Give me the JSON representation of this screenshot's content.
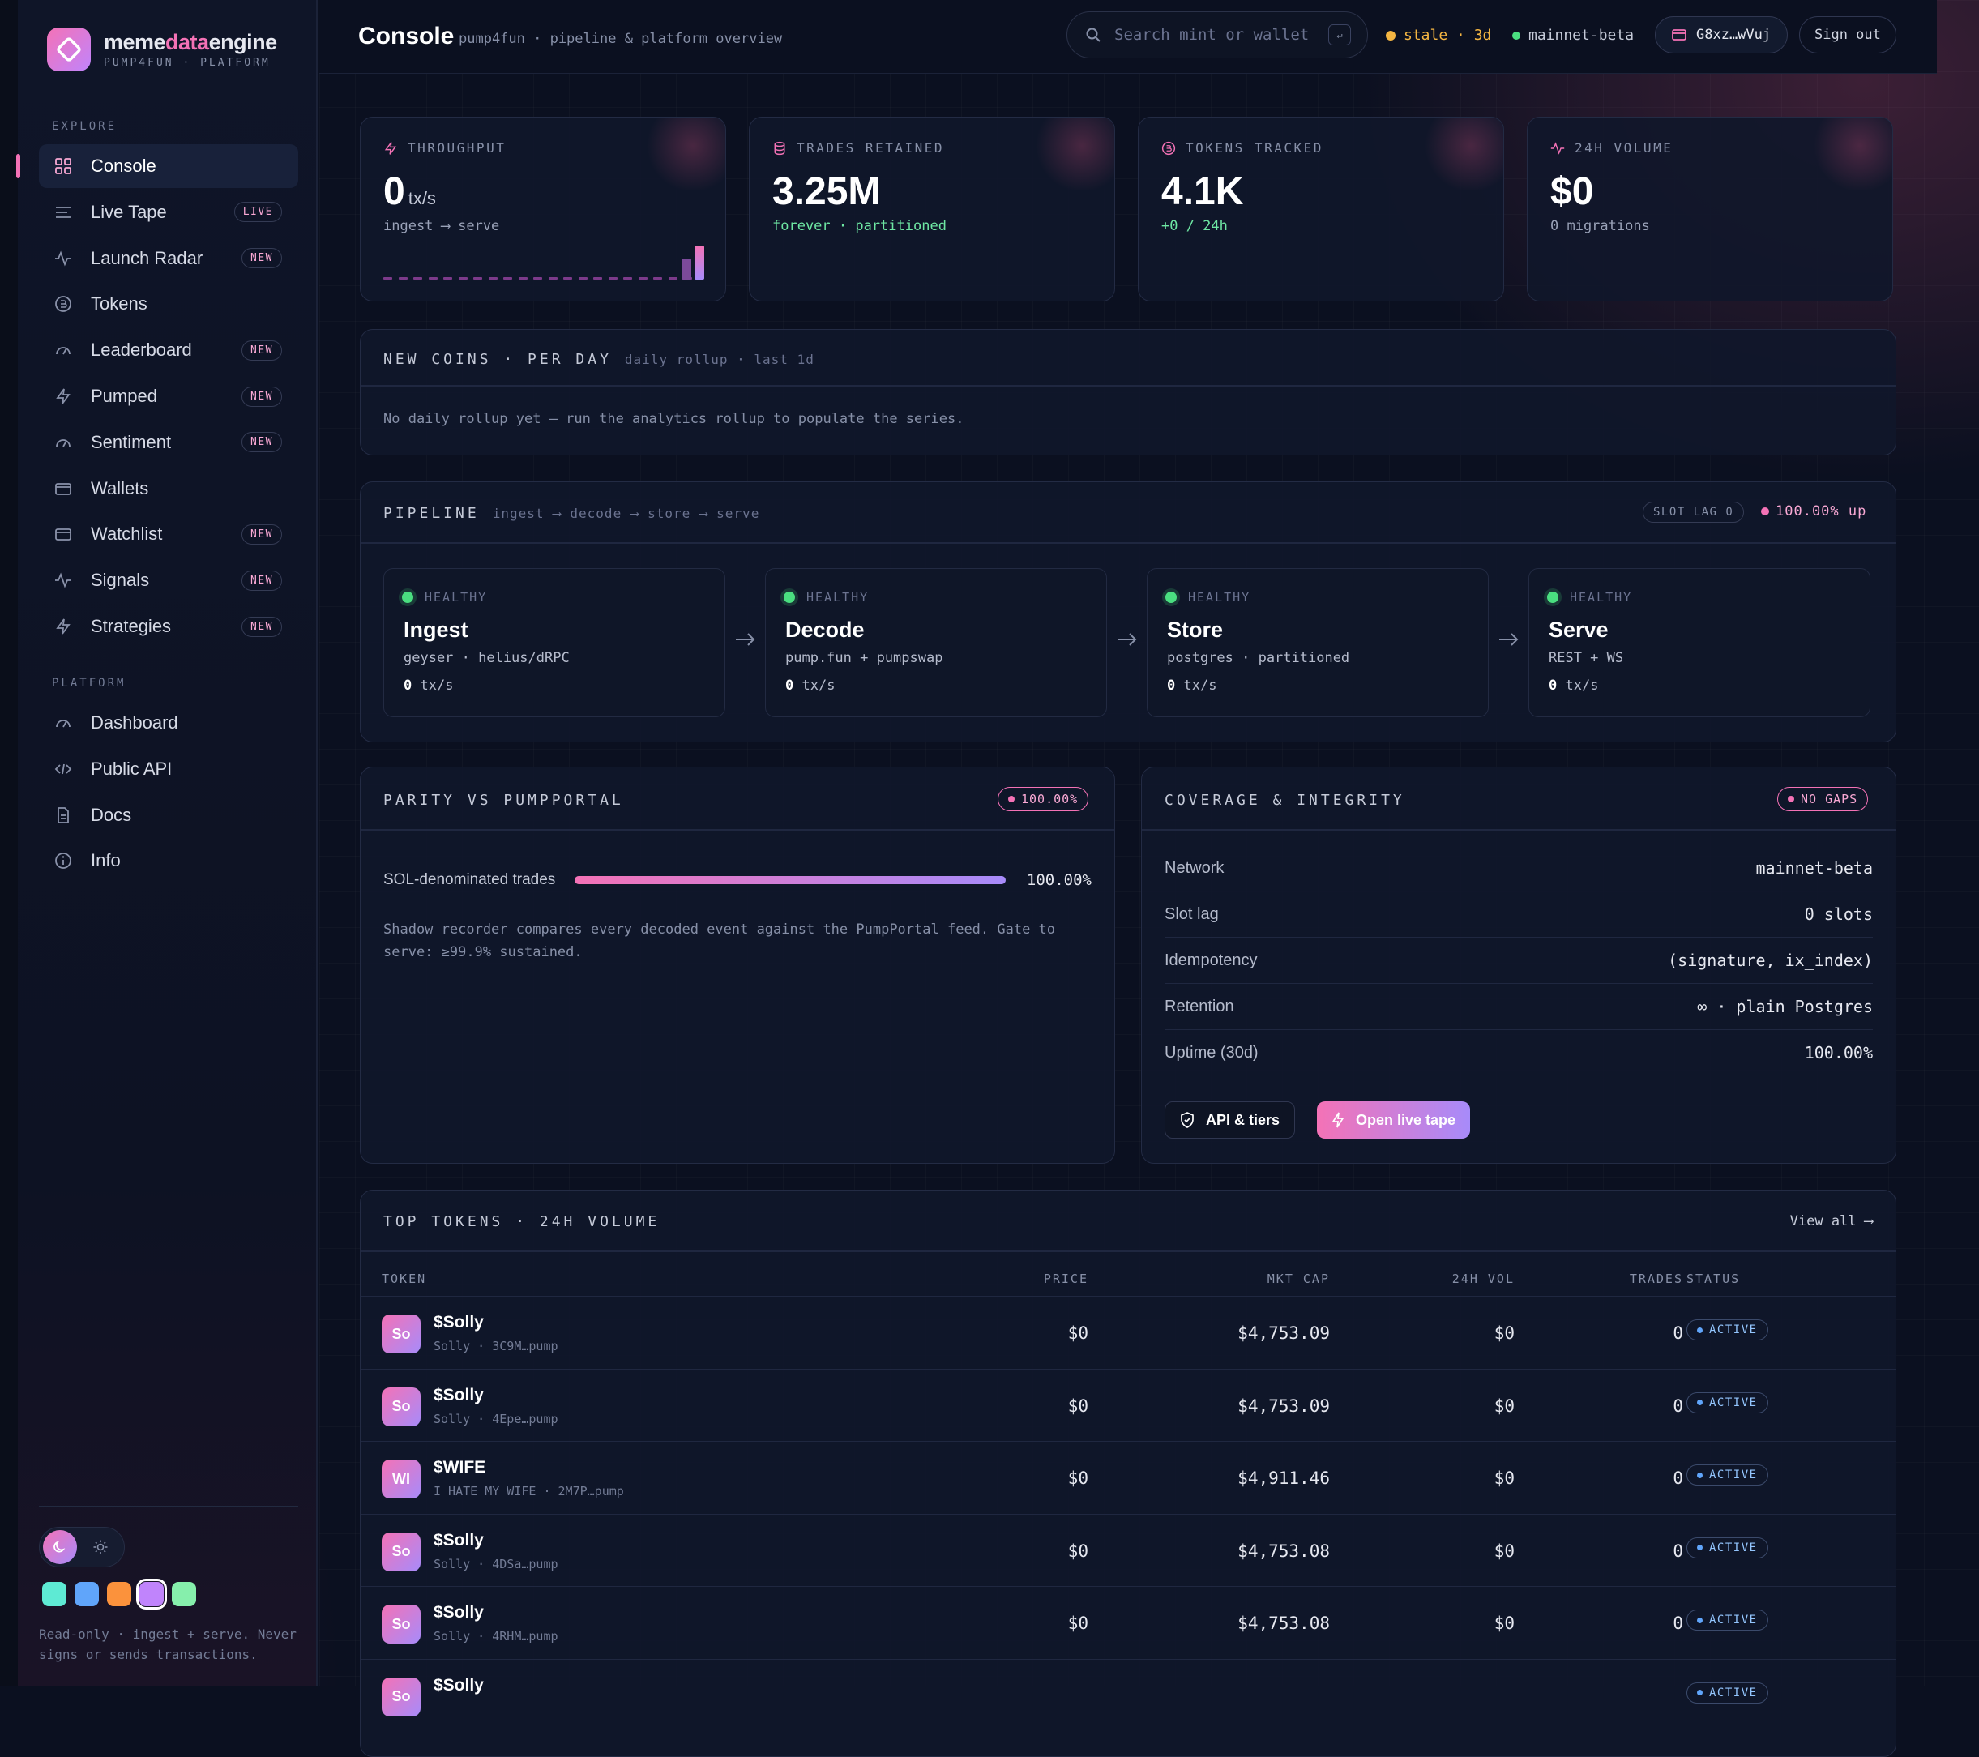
{
  "brand": {
    "name_part1": "meme",
    "name_part2": "data",
    "name_part3": "engine",
    "subtitle": "PUMP4FUN · PLATFORM"
  },
  "sidebar": {
    "explore_label": "EXPLORE",
    "platform_label": "PLATFORM",
    "explore_items": [
      {
        "label": "Console",
        "badge": "",
        "icon": "grid-icon",
        "active": true
      },
      {
        "label": "Live Tape",
        "badge": "LIVE",
        "icon": "lines-icon"
      },
      {
        "label": "Launch Radar",
        "badge": "NEW",
        "icon": "pulse-icon"
      },
      {
        "label": "Tokens",
        "badge": "",
        "icon": "coin-icon"
      },
      {
        "label": "Leaderboard",
        "badge": "NEW",
        "icon": "gauge-icon"
      },
      {
        "label": "Pumped",
        "badge": "NEW",
        "icon": "bolt-icon"
      },
      {
        "label": "Sentiment",
        "badge": "NEW",
        "icon": "gauge-icon"
      },
      {
        "label": "Wallets",
        "badge": "",
        "icon": "wallet-icon"
      },
      {
        "label": "Watchlist",
        "badge": "NEW",
        "icon": "wallet-icon"
      },
      {
        "label": "Signals",
        "badge": "NEW",
        "icon": "pulse-icon"
      },
      {
        "label": "Strategies",
        "badge": "NEW",
        "icon": "bolt-icon"
      }
    ],
    "platform_items": [
      {
        "label": "Dashboard",
        "icon": "gauge-icon"
      },
      {
        "label": "Public API",
        "icon": "code-icon"
      },
      {
        "label": "Docs",
        "icon": "doc-icon"
      },
      {
        "label": "Info",
        "icon": "info-icon"
      }
    ],
    "swatch_colors": [
      "#5eead4",
      "#60a5fa",
      "#fb923c",
      "#c084fc",
      "#86efac"
    ],
    "footer_note": "Read-only · ingest + serve. Never signs or sends transactions."
  },
  "header": {
    "title": "Console",
    "subtitle": "pump4fun · pipeline & platform overview",
    "search_placeholder": "Search mint or wallet",
    "search_kbd": "↵",
    "stale_label": "stale · 3d",
    "network_label": "mainnet-beta",
    "wallet_label": "G8xz…wVuj",
    "signout_label": "Sign out"
  },
  "stats": [
    {
      "label": "THROUGHPUT",
      "value": "0",
      "unit": "tx/s",
      "sub": "ingest ⟶ serve",
      "sub_color": "muted",
      "icon": "bolt-icon"
    },
    {
      "label": "TRADES RETAINED",
      "value": "3.25M",
      "unit": "",
      "sub": "forever · partitioned",
      "sub_color": "green",
      "icon": "database-icon"
    },
    {
      "label": "TOKENS TRACKED",
      "value": "4.1K",
      "unit": "",
      "sub": "+0 / 24h",
      "sub_color": "green",
      "icon": "coin-icon"
    },
    {
      "label": "24H VOLUME",
      "value": "$0",
      "unit": "",
      "sub": "0 migrations",
      "sub_color": "muted",
      "icon": "pulse-icon"
    }
  ],
  "new_coins": {
    "title": "NEW COINS · PER DAY",
    "meta": "daily rollup · last 1d",
    "empty": "No daily rollup yet — run the analytics rollup to populate the series."
  },
  "pipeline": {
    "title": "PIPELINE",
    "flow": "ingest ⟶ decode ⟶ store ⟶ serve",
    "slot_lag": "SLOT LAG 0",
    "uptime": "100.00% up",
    "stages": [
      {
        "status": "HEALTHY",
        "name": "Ingest",
        "desc": "geyser · helius/dRPC",
        "rate_value": "0",
        "rate_unit": "tx/s"
      },
      {
        "status": "HEALTHY",
        "name": "Decode",
        "desc": "pump.fun + pumpswap",
        "rate_value": "0",
        "rate_unit": "tx/s"
      },
      {
        "status": "HEALTHY",
        "name": "Store",
        "desc": "postgres · partitioned",
        "rate_value": "0",
        "rate_unit": "tx/s"
      },
      {
        "status": "HEALTHY",
        "name": "Serve",
        "desc": "REST + WS",
        "rate_value": "0",
        "rate_unit": "tx/s"
      }
    ]
  },
  "parity": {
    "title": "PARITY VS PUMPPORTAL",
    "badge": "100.00%",
    "metric_label": "SOL-denominated trades",
    "metric_value": "100.00%",
    "metric_fraction": 1.0,
    "note": "Shadow recorder compares every decoded event against the PumpPortal feed. Gate to serve: ≥99.9% sustained."
  },
  "coverage": {
    "title": "COVERAGE & INTEGRITY",
    "badge": "NO GAPS",
    "rows": [
      {
        "k": "Network",
        "v": "mainnet-beta"
      },
      {
        "k": "Slot lag",
        "v": "0 slots"
      },
      {
        "k": "Idempotency",
        "v": "(signature, ix_index)"
      },
      {
        "k": "Retention",
        "v": "∞ · plain Postgres"
      },
      {
        "k": "Uptime (30d)",
        "v": "100.00%"
      }
    ],
    "api_button": "API & tiers",
    "tape_button": "Open live tape"
  },
  "top_tokens": {
    "title": "TOP TOKENS · 24H VOLUME",
    "view_all": "View all ⟶",
    "columns": {
      "token": "TOKEN",
      "price": "PRICE",
      "mcap": "MKT CAP",
      "vol": "24H VOL",
      "trades": "TRADES",
      "status": "STATUS"
    },
    "rows": [
      {
        "avatar": "So",
        "symbol": "$Solly",
        "sub": "Solly · 3C9M…pump",
        "price": "$0",
        "mcap": "$4,753.09",
        "vol": "$0",
        "trades": "0",
        "status": "ACTIVE"
      },
      {
        "avatar": "So",
        "symbol": "$Solly",
        "sub": "Solly · 4Epe…pump",
        "price": "$0",
        "mcap": "$4,753.09",
        "vol": "$0",
        "trades": "0",
        "status": "ACTIVE"
      },
      {
        "avatar": "WI",
        "symbol": "$WIFE",
        "sub": "I HATE MY WIFE · 2M7P…pump",
        "price": "$0",
        "mcap": "$4,911.46",
        "vol": "$0",
        "trades": "0",
        "status": "ACTIVE"
      },
      {
        "avatar": "So",
        "symbol": "$Solly",
        "sub": "Solly · 4DSa…pump",
        "price": "$0",
        "mcap": "$4,753.08",
        "vol": "$0",
        "trades": "0",
        "status": "ACTIVE"
      },
      {
        "avatar": "So",
        "symbol": "$Solly",
        "sub": "Solly · 4RHM…pump",
        "price": "$0",
        "mcap": "$4,753.08",
        "vol": "$0",
        "trades": "0",
        "status": "ACTIVE"
      },
      {
        "avatar": "So",
        "symbol": "$Solly",
        "sub": "",
        "price": "",
        "mcap": "",
        "vol": "",
        "trades": "",
        "status": "ACTIVE"
      }
    ]
  },
  "colors": {
    "accent": "#f472b6",
    "accent2": "#a78bfa",
    "healthy": "#4ade80",
    "stale": "#f5b642"
  }
}
